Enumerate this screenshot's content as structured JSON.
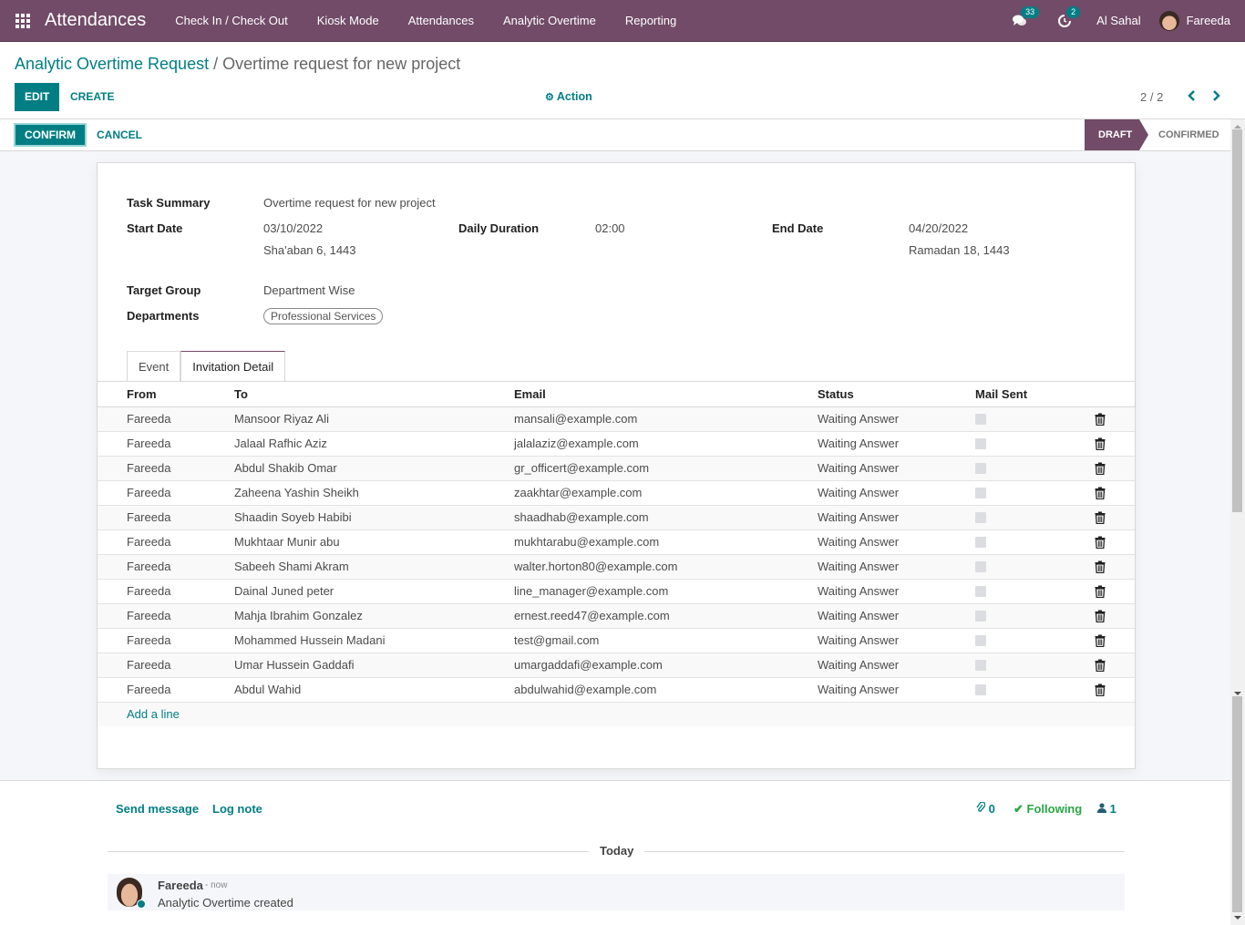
{
  "navbar": {
    "app_name": "Attendances",
    "menu": [
      "Check In / Check Out",
      "Kiosk Mode",
      "Attendances",
      "Analytic Overtime",
      "Reporting"
    ],
    "messages_count": "33",
    "activities_count": "2",
    "company": "Al Sahal",
    "user": "Fareeda"
  },
  "breadcrumb": {
    "parent": "Analytic Overtime Request",
    "separator": " / ",
    "current": "Overtime request for new project"
  },
  "control_panel": {
    "edit_label": "EDIT",
    "create_label": "CREATE",
    "action_label": "Action",
    "pager": "2 / 2"
  },
  "statusbar": {
    "confirm_label": "CONFIRM",
    "cancel_label": "CANCEL",
    "stages": [
      "DRAFT",
      "CONFIRMED"
    ],
    "current_stage": "DRAFT"
  },
  "form": {
    "task_summary_label": "Task Summary",
    "task_summary": "Overtime request for new project",
    "start_date_label": "Start Date",
    "start_date": "03/10/2022",
    "start_date_hijri": "Sha'aban 6, 1443",
    "daily_duration_label": "Daily Duration",
    "daily_duration": "02:00",
    "end_date_label": "End Date",
    "end_date": "04/20/2022",
    "end_date_hijri": "Ramadan 18, 1443",
    "target_group_label": "Target Group",
    "target_group": "Department Wise",
    "departments_label": "Departments",
    "departments": [
      "Professional Services"
    ]
  },
  "tabs": [
    {
      "label": "Event",
      "active": false
    },
    {
      "label": "Invitation Detail",
      "active": true
    }
  ],
  "invitations": {
    "columns": [
      "From",
      "To",
      "Email",
      "Status",
      "Mail Sent"
    ],
    "rows": [
      {
        "from": "Fareeda",
        "to": "Mansoor Riyaz Ali",
        "email": "mansali@example.com",
        "status": "Waiting Answer",
        "mail_sent": false
      },
      {
        "from": "Fareeda",
        "to": "Jalaal Rafhic Aziz",
        "email": "jalalaziz@example.com",
        "status": "Waiting Answer",
        "mail_sent": false
      },
      {
        "from": "Fareeda",
        "to": "Abdul Shakib Omar",
        "email": "gr_officert@example.com",
        "status": "Waiting Answer",
        "mail_sent": false
      },
      {
        "from": "Fareeda",
        "to": "Zaheena Yashin Sheikh",
        "email": "zaakhtar@example.com",
        "status": "Waiting Answer",
        "mail_sent": false
      },
      {
        "from": "Fareeda",
        "to": "Shaadin Soyeb Habibi",
        "email": "shaadhab@example.com",
        "status": "Waiting Answer",
        "mail_sent": false
      },
      {
        "from": "Fareeda",
        "to": "Mukhtaar Munir abu",
        "email": "mukhtarabu@example.com",
        "status": "Waiting Answer",
        "mail_sent": false
      },
      {
        "from": "Fareeda",
        "to": "Sabeeh Shami Akram",
        "email": "walter.horton80@example.com",
        "status": "Waiting Answer",
        "mail_sent": false
      },
      {
        "from": "Fareeda",
        "to": "Dainal Juned peter",
        "email": "line_manager@example.com",
        "status": "Waiting Answer",
        "mail_sent": false
      },
      {
        "from": "Fareeda",
        "to": "Mahja Ibrahim Gonzalez",
        "email": "ernest.reed47@example.com",
        "status": "Waiting Answer",
        "mail_sent": false
      },
      {
        "from": "Fareeda",
        "to": "Mohammed Hussein Madani",
        "email": "test@gmail.com",
        "status": "Waiting Answer",
        "mail_sent": false
      },
      {
        "from": "Fareeda",
        "to": "Umar Hussein Gaddafi",
        "email": "umargaddafi@example.com",
        "status": "Waiting Answer",
        "mail_sent": false
      },
      {
        "from": "Fareeda",
        "to": "Abdul Wahid",
        "email": "abdulwahid@example.com",
        "status": "Waiting Answer",
        "mail_sent": false
      }
    ],
    "add_line_label": "Add a line"
  },
  "chatter": {
    "send_message_label": "Send message",
    "log_note_label": "Log note",
    "attachments_count": "0",
    "following_label": "Following",
    "followers_count": "1",
    "date_separator": "Today",
    "messages": [
      {
        "author": "Fareeda",
        "date": "- now",
        "body": "Analytic Overtime created"
      }
    ]
  },
  "colors": {
    "brand": "#714b67",
    "accent": "#017e84",
    "following": "#28a745"
  }
}
